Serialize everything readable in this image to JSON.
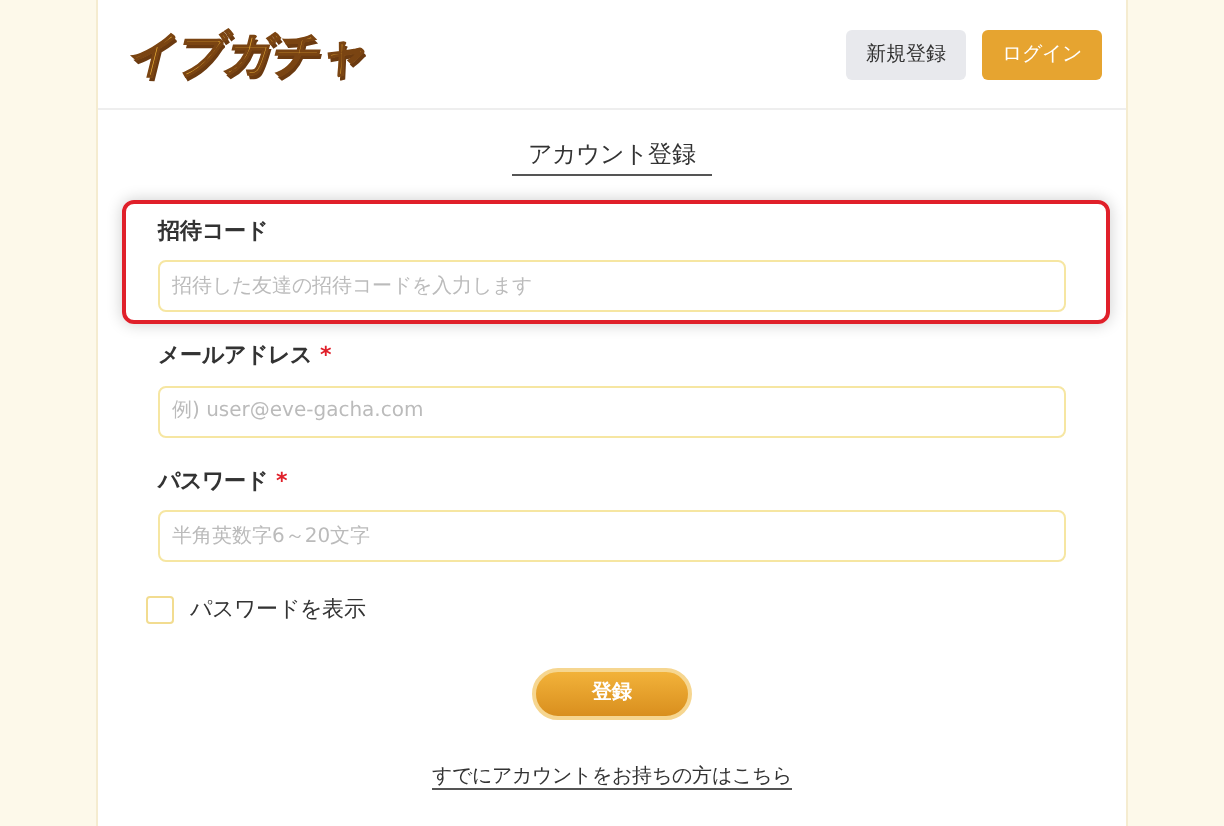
{
  "header": {
    "logo": "イブガチャ",
    "buttons": [
      {
        "label": "新規登録",
        "kind": "secondary"
      },
      {
        "label": "ログイン",
        "kind": "primary"
      }
    ]
  },
  "title": "アカウント登録",
  "fields": [
    {
      "label": "招待コード",
      "placeholder": "招待した友達の招待コードを入力します",
      "required": false,
      "highlighted": true
    },
    {
      "label": "メールアドレス",
      "placeholder": "例) user@eve-gacha.com",
      "required": true,
      "highlighted": false
    },
    {
      "label": "パスワード",
      "placeholder": "半角英数字6～20文字",
      "required": true,
      "highlighted": false
    }
  ],
  "required_mark": "*",
  "show_password": {
    "label": "パスワードを表示",
    "checked": false
  },
  "submit": "登録",
  "login_link": "すでにアカウントをお持ちの方はこちら"
}
